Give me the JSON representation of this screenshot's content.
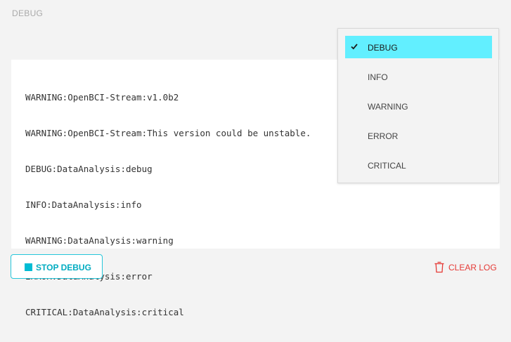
{
  "panel": {
    "title": "DEBUG"
  },
  "log": {
    "lines": [
      "WARNING:OpenBCI-Stream:v1.0b2",
      "WARNING:OpenBCI-Stream:This version could be unstable.",
      "DEBUG:DataAnalysis:debug",
      "INFO:DataAnalysis:info",
      "WARNING:DataAnalysis:warning",
      "ERROR:DataAnalysis:error",
      "CRITICAL:DataAnalysis:critical"
    ]
  },
  "level_menu": {
    "selected": "DEBUG",
    "options": [
      "DEBUG",
      "INFO",
      "WARNING",
      "ERROR",
      "CRITICAL"
    ]
  },
  "buttons": {
    "stop_debug": "STOP DEBUG",
    "clear_log": "CLEAR LOG"
  },
  "icons": {
    "stop": "square-stop-icon",
    "clear": "trash-icon",
    "check": "check-icon"
  },
  "colors": {
    "accent": "#00bcd4",
    "selected_bg": "#62efff",
    "danger": "#e53935"
  }
}
